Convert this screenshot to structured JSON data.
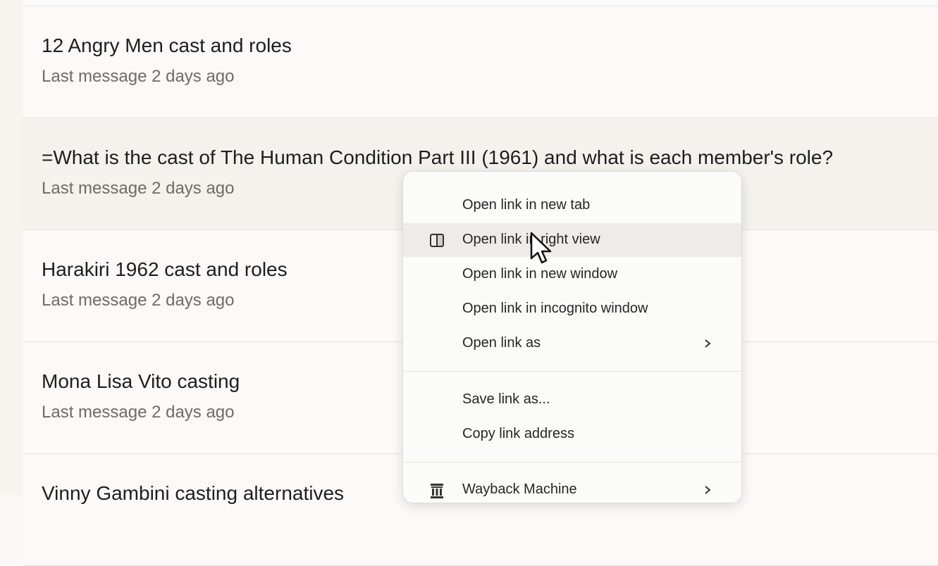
{
  "chats": [
    {
      "title": "12 Angry Men cast and roles",
      "meta": "Last message 2 days ago"
    },
    {
      "title": "=What is the cast of The Human Condition Part III (1961) and what is each member's role?",
      "meta": "Last message 2 days ago"
    },
    {
      "title": "Harakiri 1962 cast and roles",
      "meta": "Last message 2 days ago"
    },
    {
      "title": "Mona Lisa Vito casting",
      "meta": "Last message 2 days ago"
    },
    {
      "title": "Vinny Gambini casting alternatives",
      "meta": ""
    }
  ],
  "context_menu": {
    "items": [
      {
        "label": "Open link in new tab"
      },
      {
        "label": "Open link in right view",
        "icon": "split-view-icon"
      },
      {
        "label": "Open link in new window"
      },
      {
        "label": "Open link in incognito window"
      },
      {
        "label": "Open link as",
        "submenu": true
      },
      {
        "label": "Save link as..."
      },
      {
        "label": "Copy link address"
      },
      {
        "label": "Wayback Machine",
        "icon": "wayback-machine-icon",
        "submenu": true
      }
    ]
  }
}
